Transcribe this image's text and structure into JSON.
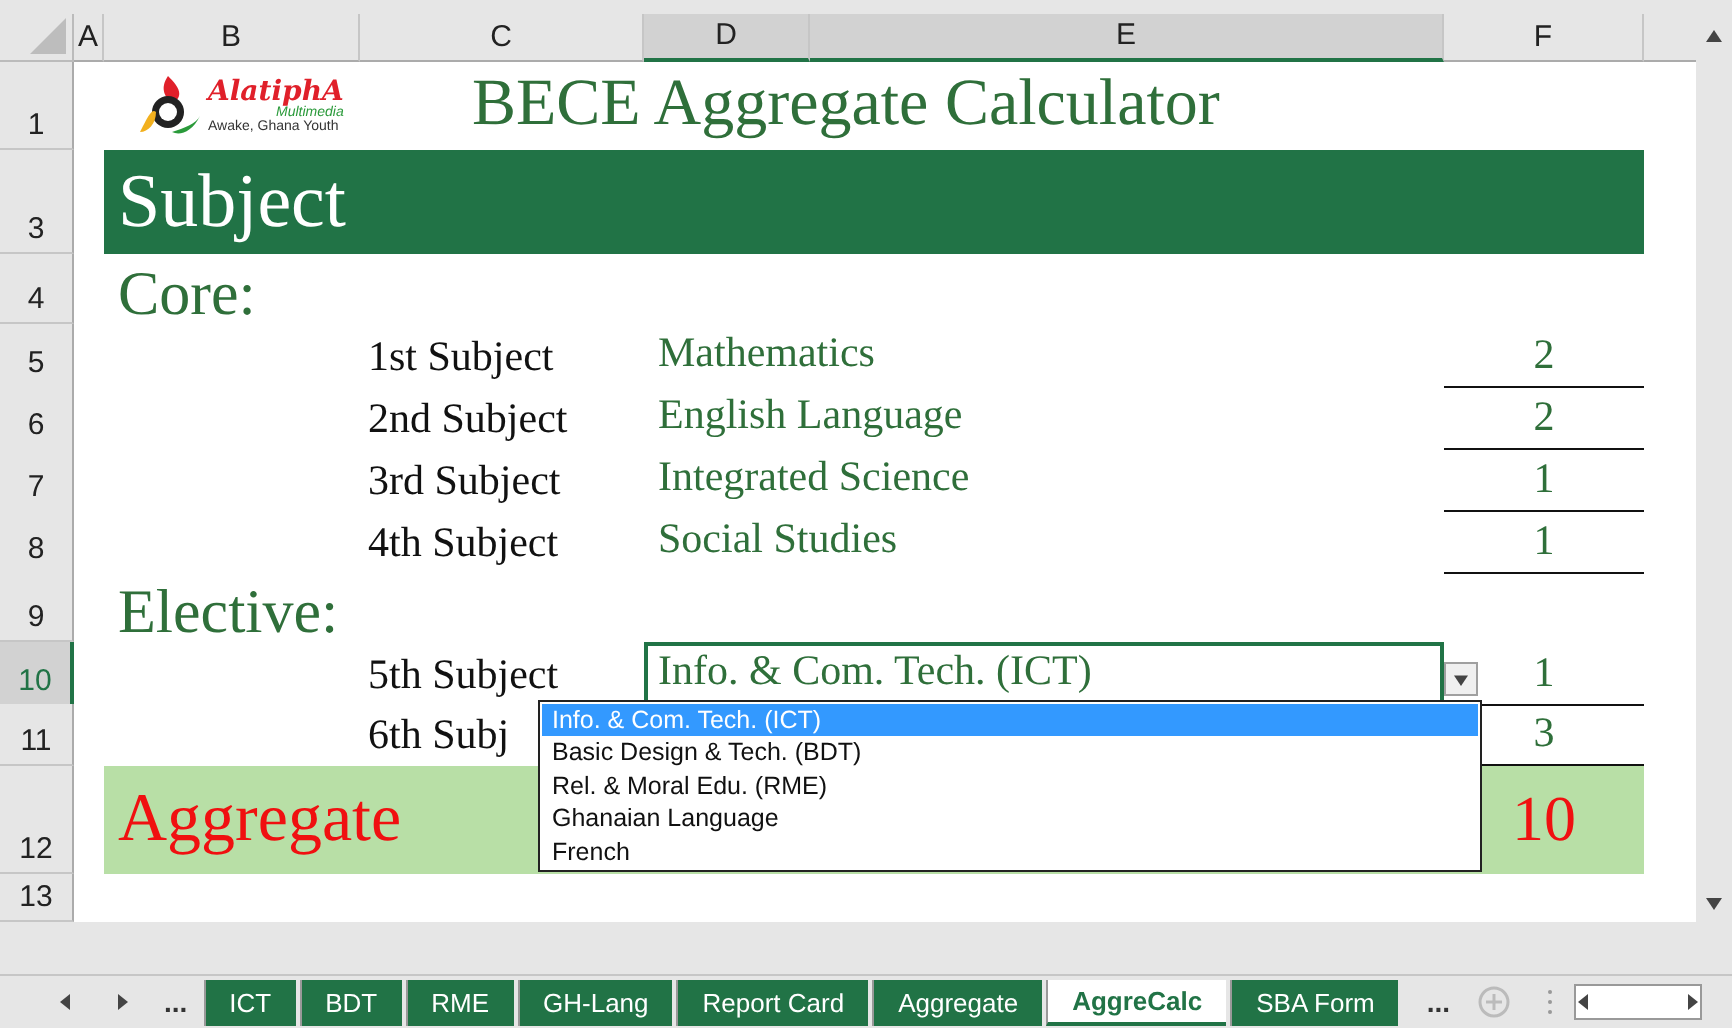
{
  "columns": [
    {
      "label": "A",
      "selected": false
    },
    {
      "label": "B",
      "selected": false
    },
    {
      "label": "C",
      "selected": false
    },
    {
      "label": "D",
      "selected": true
    },
    {
      "label": "E",
      "selected": true
    },
    {
      "label": "F",
      "selected": false
    }
  ],
  "rows": [
    {
      "number": "1",
      "selected": false,
      "kind": "title",
      "logo": {
        "name": "AlatiphA",
        "sub": "Multimedia",
        "tagline": "Awake, Ghana Youth"
      },
      "title": "BECE Aggregate Calculator"
    },
    {
      "number": "3",
      "selected": false,
      "kind": "band",
      "text": "Subject"
    },
    {
      "number": "4",
      "selected": false,
      "kind": "heading",
      "text": "Core:"
    },
    {
      "number": "5",
      "selected": false,
      "kind": "subject",
      "label": "1st Subject",
      "subject": "Mathematics",
      "grade": "2",
      "active": false
    },
    {
      "number": "6",
      "selected": false,
      "kind": "subject",
      "label": "2nd Subject",
      "subject": "English Language",
      "grade": "2",
      "active": false
    },
    {
      "number": "7",
      "selected": false,
      "kind": "subject",
      "label": "3rd Subject",
      "subject": "Integrated Science",
      "grade": "1",
      "active": false
    },
    {
      "number": "8",
      "selected": false,
      "kind": "subject",
      "label": "4th Subject",
      "subject": "Social Studies",
      "grade": "1",
      "active": false
    },
    {
      "number": "9",
      "selected": false,
      "kind": "heading",
      "text": "Elective:"
    },
    {
      "number": "10",
      "selected": true,
      "kind": "subject",
      "label": "5th Subject",
      "subject": "Info. & Com. Tech. (ICT)",
      "grade": "1",
      "active": true
    },
    {
      "number": "11",
      "selected": false,
      "kind": "subject",
      "label": "6th Subj",
      "grade": "3"
    },
    {
      "number": "12",
      "selected": false,
      "kind": "total",
      "label": "Aggregate",
      "value": "10"
    },
    {
      "number": "13",
      "selected": false,
      "kind": "empty"
    }
  ],
  "dropdown": {
    "items": [
      {
        "label": "Info. & Com. Tech. (ICT)",
        "selected": true
      },
      {
        "label": "Basic Design & Tech. (BDT)",
        "selected": false
      },
      {
        "label": "Rel. & Moral Edu. (RME)",
        "selected": false
      },
      {
        "label": "Ghanaian Language",
        "selected": false
      },
      {
        "label": "French",
        "selected": false
      }
    ]
  },
  "sheet_tabs": {
    "more_left": "...",
    "more_right": "...",
    "tabs": [
      {
        "label": "ICT",
        "selected": false
      },
      {
        "label": "BDT",
        "selected": false
      },
      {
        "label": "RME",
        "selected": false
      },
      {
        "label": "GH-Lang",
        "selected": false
      },
      {
        "label": "Report Card",
        "selected": false
      },
      {
        "label": "Aggregate",
        "selected": false
      },
      {
        "label": "AggreCalc",
        "selected": true
      },
      {
        "label": "SBA Form",
        "selected": false
      }
    ]
  }
}
